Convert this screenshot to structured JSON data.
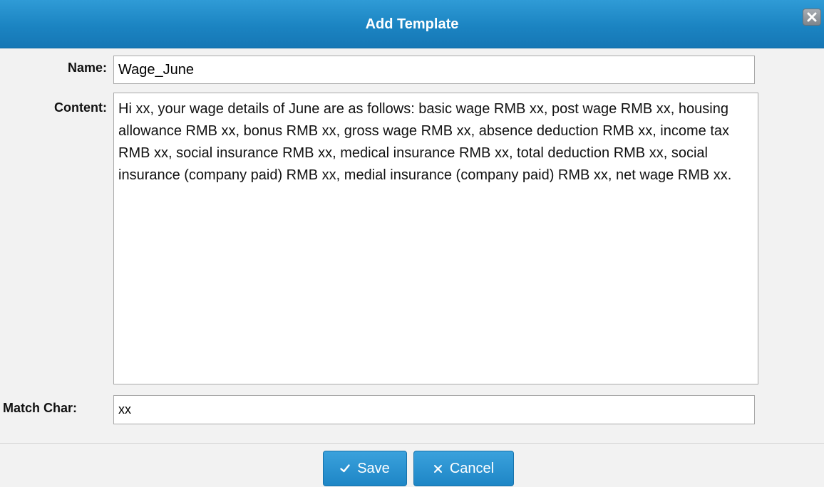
{
  "dialog": {
    "title": "Add Template"
  },
  "form": {
    "name_label": "Name:",
    "name_value": "Wage_June",
    "content_label": "Content:",
    "content_value": "Hi xx, your wage details of June are as follows: basic wage RMB xx, post wage RMB xx, housing allowance RMB xx, bonus RMB xx, gross wage RMB xx, absence deduction RMB xx, income tax RMB xx, social insurance RMB xx, medical insurance RMB xx, total deduction RMB xx, social insurance (company paid) RMB xx, medial insurance (company paid) RMB xx, net wage RMB xx.",
    "match_label": "Match Char:",
    "match_value": "xx"
  },
  "buttons": {
    "save_label": "Save",
    "cancel_label": "Cancel"
  },
  "icons": {
    "close": "close-icon",
    "save": "checkmark-icon",
    "cancel": "x-icon"
  },
  "colors": {
    "titlebar": "#1b84c2",
    "button": "#1e86c6",
    "background": "#f2f2f2"
  }
}
